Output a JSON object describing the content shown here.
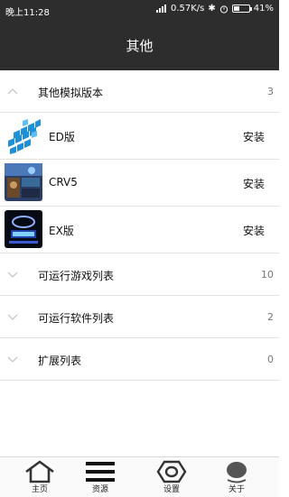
{
  "status": {
    "time": "晚上11:28",
    "speed": "0.57K/s",
    "battery": "41%",
    "battery_level": 0.41
  },
  "header": {
    "title": "其他"
  },
  "section_other": {
    "label": "其他模拟版本",
    "count": "3"
  },
  "apps": [
    {
      "name": "ED版",
      "install": "安装",
      "icon": "ed-app-icon"
    },
    {
      "name": "CRV5",
      "install": "安装",
      "icon": "crv5-app-icon"
    },
    {
      "name": "EX版",
      "install": "安装",
      "icon": "ex-app-icon"
    }
  ],
  "sections": [
    {
      "label": "可运行游戏列表",
      "count": "10"
    },
    {
      "label": "可运行软件列表",
      "count": "2"
    },
    {
      "label": "扩展列表",
      "count": "0"
    }
  ],
  "tabs": [
    {
      "label": "主页",
      "icon": "home-icon"
    },
    {
      "label": "资源",
      "icon": "menu-lines-icon"
    },
    {
      "label": "设置",
      "icon": "hexagon-settings-icon"
    },
    {
      "label": "关于",
      "icon": "about-icon"
    }
  ]
}
